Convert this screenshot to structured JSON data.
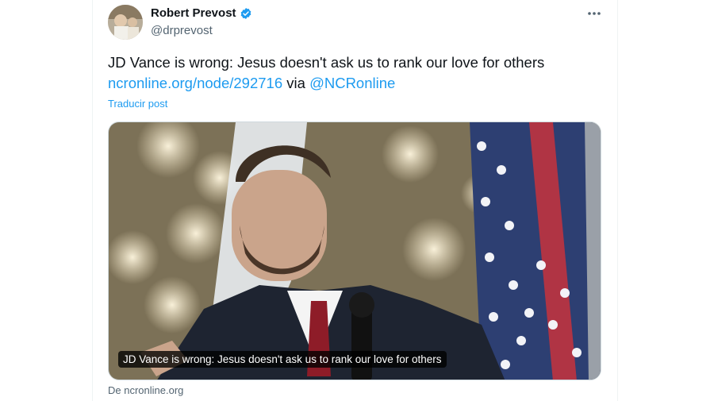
{
  "author": {
    "name": "Robert Prevost",
    "handle": "@drprevost",
    "verified_color": "#1d9bf0"
  },
  "icons": {
    "more": "more-horizontal-icon",
    "verified": "verified-badge-icon"
  },
  "post": {
    "text": "JD Vance is wrong: Jesus doesn't ask us to rank our love for others",
    "link": "ncronline.org/node/292716",
    "via": " via ",
    "mention": "@NCRonline",
    "translate_label": "Traducir post"
  },
  "card": {
    "caption": "JD Vance is wrong: Jesus doesn't ask us to rank our love for others",
    "source": "De ncronline.org"
  },
  "colors": {
    "text": "#0f1419",
    "secondary": "#536471",
    "accent": "#1d9bf0"
  }
}
